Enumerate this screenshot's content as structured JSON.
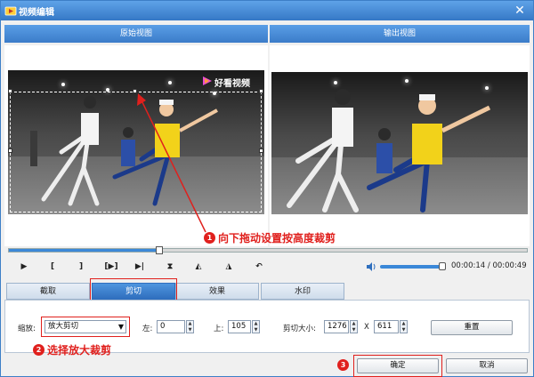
{
  "window": {
    "title": "视频编辑",
    "close_label": "✕"
  },
  "views": {
    "original": "原始视图",
    "output": "输出视图"
  },
  "watermark": {
    "text": "好看视频"
  },
  "annotations": {
    "step1_number": "1",
    "step1_text": "向下拖动设置按高度裁剪",
    "step2_number": "2",
    "step2_text": "选择放大裁剪",
    "step3_number": "3"
  },
  "playback": {
    "controls": [
      {
        "name": "play-button",
        "glyph": "▶"
      },
      {
        "name": "mark-in-button",
        "glyph": "["
      },
      {
        "name": "mark-out-button",
        "glyph": "]"
      },
      {
        "name": "play-selection-button",
        "glyph": "[▶]"
      },
      {
        "name": "prev-frame-button",
        "glyph": "▶|"
      },
      {
        "name": "split-button",
        "glyph": "⧗"
      },
      {
        "name": "rotate-left-button",
        "glyph": "◭"
      },
      {
        "name": "rotate-right-button",
        "glyph": "◮"
      },
      {
        "name": "undo-button",
        "glyph": "↶"
      }
    ],
    "progress": 0.29,
    "volume": 0.95,
    "time_display": "00:00:14 / 00:00:49"
  },
  "tabs": [
    {
      "label": "截取",
      "active": false
    },
    {
      "label": "剪切",
      "active": true
    },
    {
      "label": "效果",
      "active": false
    },
    {
      "label": "水印",
      "active": false
    }
  ],
  "crop_panel": {
    "zoom_label": "缩放:",
    "zoom_value": "放大剪切",
    "left_label": "左:",
    "left_value": "0",
    "top_label": "上:",
    "top_value": "105",
    "size_label": "剪切大小:",
    "width_value": "1276",
    "times_label": "X",
    "height_value": "611",
    "reset_label": "重置"
  },
  "footer": {
    "ok_label": "确定",
    "cancel_label": "取消"
  },
  "colors": {
    "title_bar": "#3578c6",
    "accent": "#2f6fbe",
    "annotation": "#e0201d",
    "shirt_yellow": "#f2d21a"
  }
}
